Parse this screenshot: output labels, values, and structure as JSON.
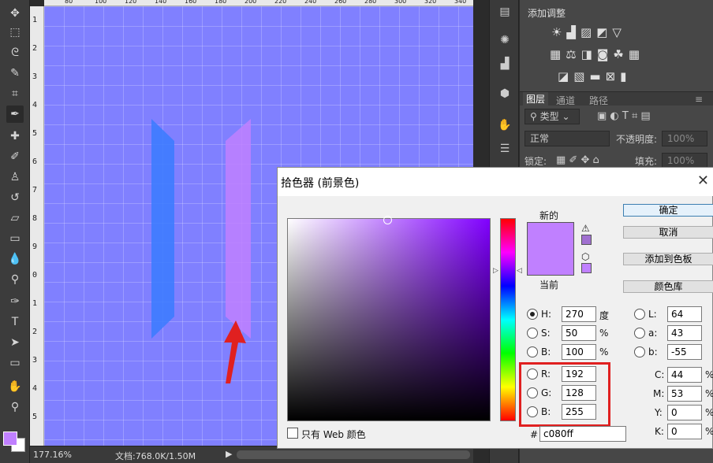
{
  "status_bar": {
    "zoom": "177.16%",
    "document_info": "文档:768.0K/1.50M"
  },
  "rulers": {
    "horizontal_ticks": [
      "80",
      "100",
      "120",
      "140",
      "160",
      "180",
      "200",
      "220",
      "240",
      "260",
      "280",
      "300",
      "320",
      "340"
    ],
    "vertical_ticks": [
      "1",
      "2",
      "3",
      "4",
      "5",
      "6",
      "7",
      "8",
      "9",
      "0",
      "1",
      "2",
      "3",
      "4",
      "5"
    ]
  },
  "adjustments_panel": {
    "title": "添加调整"
  },
  "layers_panel": {
    "tabs": [
      "图层",
      "通道",
      "路径"
    ],
    "kind_filter": "类型",
    "blend_mode": "正常",
    "opacity_label": "不透明度:",
    "opacity_value": "100%",
    "lock_label": "锁定:",
    "fill_label": "填充:",
    "fill_value": "100%"
  },
  "color_picker": {
    "title": "拾色器 (前景色)",
    "new_label": "新的",
    "current_label": "当前",
    "buttons": {
      "ok": "确定",
      "cancel": "取消",
      "add_to_swatches": "添加到色板",
      "color_libraries": "颜色库"
    },
    "hsb": {
      "h_label": "H:",
      "h_value": "270",
      "h_unit": "度",
      "s_label": "S:",
      "s_value": "50",
      "s_unit": "%",
      "b_label": "B:",
      "b_value": "100",
      "b_unit": "%"
    },
    "rgb": {
      "r_label": "R:",
      "r_value": "192",
      "g_label": "G:",
      "g_value": "128",
      "b_label": "B:",
      "b_value": "255"
    },
    "lab": {
      "l_label": "L:",
      "l_value": "64",
      "a_label": "a:",
      "a_value": "43",
      "b_label": "b:",
      "b_value": "-55"
    },
    "cmyk": {
      "c_label": "C:",
      "c_value": "44",
      "m_label": "M:",
      "m_value": "53",
      "y_label": "Y:",
      "y_value": "0",
      "k_label": "K:",
      "k_value": "0",
      "unit": "%"
    },
    "hex_label": "#",
    "hex_value": "c080ff",
    "web_only_label": "只有 Web 颜色"
  },
  "colors": {
    "canvas": "#8080ff",
    "new_color": "#c080ff",
    "current_color": "#c080ff",
    "highlight": "#e02020",
    "blue_bar": "#3a7bff",
    "purple_bar": "#c080ff"
  }
}
